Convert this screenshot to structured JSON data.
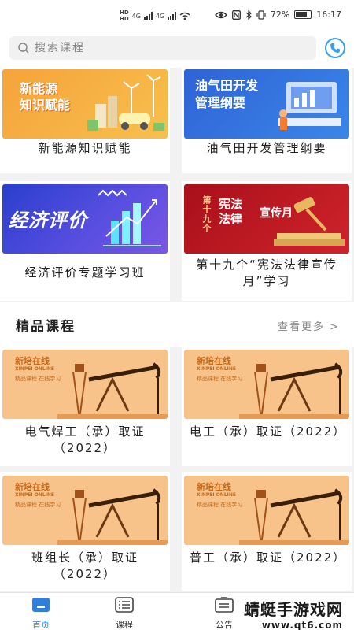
{
  "status": {
    "net": "HD",
    "signal1": "4G",
    "signal2": "4G",
    "battery": "72%",
    "time": "16:17"
  },
  "search": {
    "placeholder": "搜索课程"
  },
  "categories": [
    {
      "title": "新能源知识赋能",
      "banner": "新能源\n知识赋能"
    },
    {
      "title": "油气田开发管理纲要",
      "banner": "油气田开发\n管理纲要"
    },
    {
      "title": "经济评价专题学习班",
      "banner": "经济评价"
    },
    {
      "title": "第十九个“宪法法律宣传月”学习",
      "banner_a": "宪法\n法律",
      "banner_b": "宣传月",
      "banner_c": "第十九个"
    }
  ],
  "section": {
    "title": "精品课程",
    "more": "查看更多 >"
  },
  "courses": [
    {
      "title": "电气焊工（承）取证（2022）",
      "brand": "新培在线",
      "brand_en": "XINPEI ONLINE",
      "tag": "精品课程 在线学习"
    },
    {
      "title": "电工（承）取证（2022）",
      "brand": "新培在线",
      "brand_en": "XINPEI ONLINE",
      "tag": "精品课程 在线学习"
    },
    {
      "title": "班组长（承）取证（2022）",
      "brand": "新培在线",
      "brand_en": "XINPEI ONLINE",
      "tag": "精品课程 在线学习"
    },
    {
      "title": "普工（承）取证（2022）",
      "brand": "新培在线",
      "brand_en": "XINPEI ONLINE",
      "tag": "精品课程 在线学习"
    }
  ],
  "tabs": [
    {
      "label": "首页",
      "active": true
    },
    {
      "label": "课程",
      "active": false
    },
    {
      "label": "公告",
      "active": false
    }
  ],
  "watermark": {
    "main": "蜻蜓手游戏网",
    "sub": "www.qt6.com"
  },
  "colors": {
    "accent": "#2f7fe0",
    "phone": "#3aa0e8",
    "oil_banner": "#f8c38a"
  }
}
